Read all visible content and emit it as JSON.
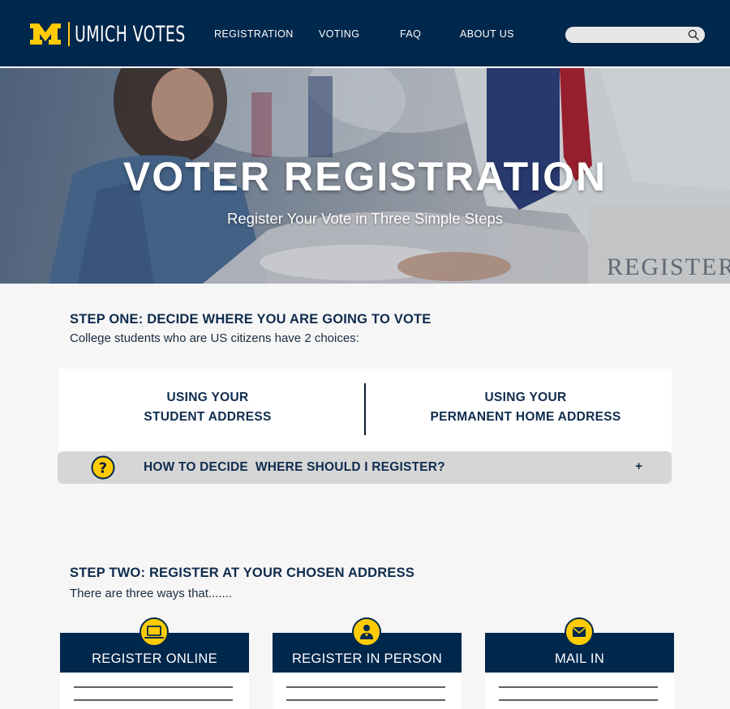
{
  "header": {
    "logo_letter": "M",
    "logo_text": "UMICH VOTES",
    "nav": [
      {
        "label": "REGISTRATION"
      },
      {
        "label": "VOTING"
      },
      {
        "label": "FAQ"
      },
      {
        "label": "ABOUT US"
      }
    ],
    "search": {
      "placeholder": "",
      "value": "",
      "icon": "search-icon"
    }
  },
  "hero": {
    "title": "VOTER REGISTRATION",
    "subtitle": "Register Your Vote in Three Simple Steps",
    "background_sign": "REGISTER"
  },
  "step_one": {
    "title": "STEP ONE: DECIDE WHERE YOU ARE GOING TO VOTE",
    "description": "College students who are US citizens have 2 choices:",
    "choices": [
      {
        "line1": "USING YOUR",
        "line2": "STUDENT ADDRESS"
      },
      {
        "line1": "USING YOUR",
        "line2": "PERMANENT HOME ADDRESS"
      }
    ],
    "accordion": {
      "icon": "question-icon",
      "label": "HOW TO DECIDE  WHERE SHOULD I REGISTER?",
      "toggle": "+"
    }
  },
  "step_two": {
    "title": "STEP TWO: REGISTER AT YOUR CHOSEN ADDRESS",
    "description": "There are three ways that.......",
    "cards": [
      {
        "label": "REGISTER ONLINE",
        "icon": "laptop-icon"
      },
      {
        "label": "REGISTER IN PERSON",
        "icon": "person-icon"
      },
      {
        "label": "MAIL IN",
        "icon": "mail-icon"
      }
    ]
  },
  "colors": {
    "navy": "#00274c",
    "maize": "#ffcb05",
    "page_bg": "#f6f6f6",
    "accordion_bg": "#d6d6d6"
  }
}
